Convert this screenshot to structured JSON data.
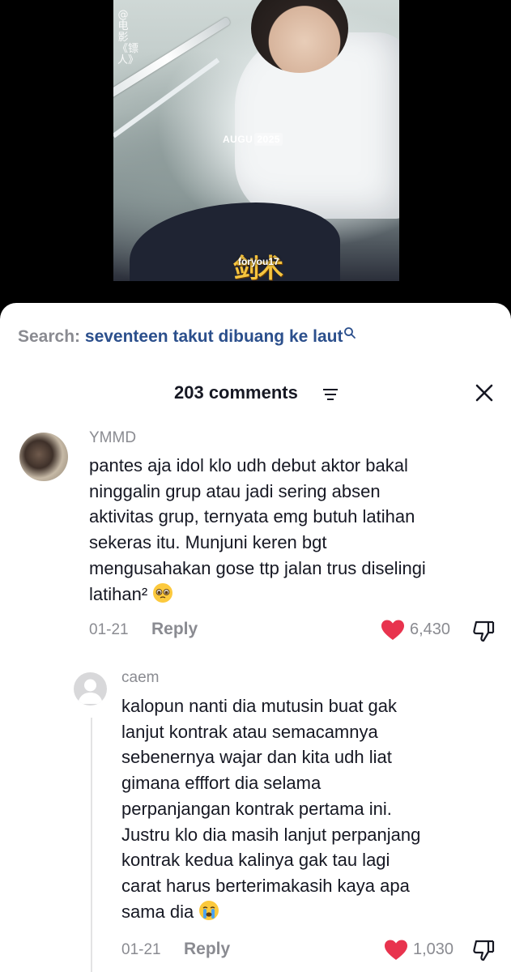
{
  "video": {
    "vertical_text": "@电影《镖人》",
    "date_month": "AUGU",
    "date_year": "2025",
    "logo_text": "剑术",
    "watermark": "foryou17"
  },
  "search": {
    "label": "Search:",
    "query": "seventeen takut dibuang ke laut",
    "icon": "search-icon"
  },
  "header": {
    "count_label": "203 comments",
    "filter_icon": "filter-icon",
    "close_icon": "close-icon"
  },
  "comments": [
    {
      "username": "YMMD",
      "lines": [
        "pantes aja idol klo udh debut aktor bakal",
        "ninggalin grup atau jadi sering absen",
        "aktivitas grup, ternyata emg butuh latihan",
        "sekeras itu. Munjuni keren bgt",
        "mengusahakan gose ttp jalan trus diselingi",
        "latihan²"
      ],
      "emoji": "pleading-face-emoji",
      "date": "01-21",
      "reply_label": "Reply",
      "likes": "6,430"
    },
    {
      "username": "caem",
      "lines": [
        "kalopun nanti dia mutusin buat gak",
        "lanjut kontrak atau semacamnya",
        "sebenernya wajar dan kita udh liat",
        "gimana efffort dia selama",
        "perpanjangan kontrak pertama ini.",
        "Justru klo dia masih lanjut perpanjang",
        "kontrak kedua kalinya gak tau lagi",
        "carat harus berterimakasih kaya apa",
        "sama dia"
      ],
      "emoji": "crying-face-emoji",
      "date": "01-21",
      "reply_label": "Reply",
      "likes": "1,030"
    }
  ],
  "colors": {
    "like_red": "#e8334e",
    "link_blue": "#2b4f8c",
    "muted_gray": "#8a8b91"
  }
}
